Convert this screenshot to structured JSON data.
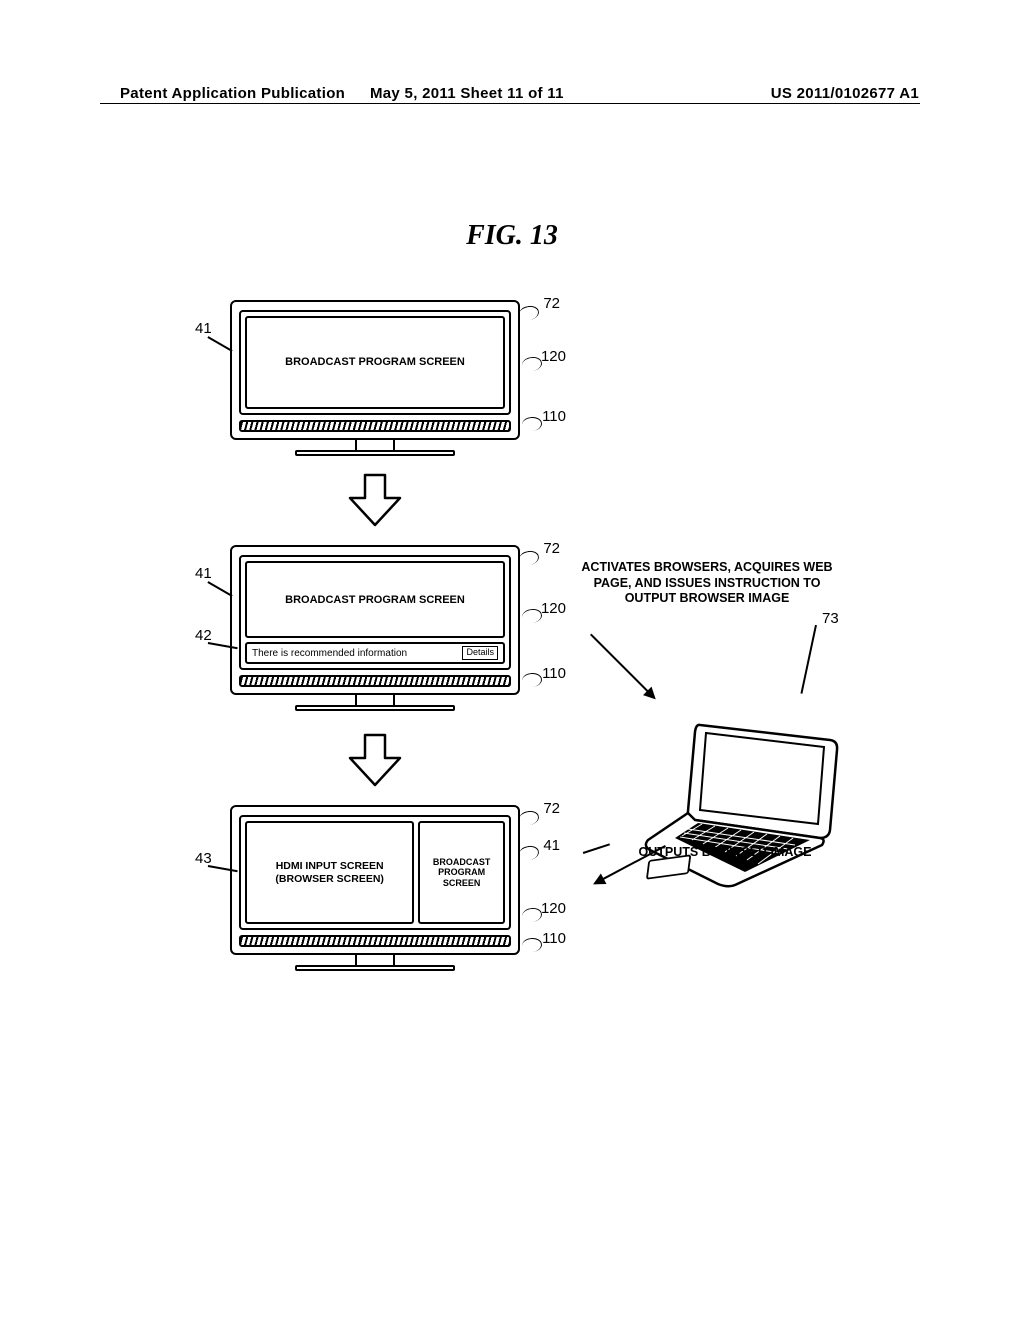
{
  "header": {
    "left": "Patent Application Publication",
    "center": "May 5, 2011   Sheet 11 of 11",
    "right": "US 2011/0102677 A1"
  },
  "figure": {
    "title": "FIG. 13"
  },
  "tv1": {
    "screen_label": "BROADCAST PROGRAM SCREEN",
    "callout_41": "41",
    "callout_72": "72",
    "callout_120": "120",
    "callout_110": "110"
  },
  "tv2": {
    "screen_label": "BROADCAST PROGRAM SCREEN",
    "info_text": "There is recommended information",
    "details_label": "Details",
    "callout_41": "41",
    "callout_42": "42",
    "callout_72": "72",
    "callout_120": "120",
    "callout_110": "110"
  },
  "side": {
    "activates_text": "ACTIVATES BROWSERS, ACQUIRES WEB PAGE, AND ISSUES INSTRUCTION TO OUTPUT BROWSER IMAGE",
    "callout_73": "73",
    "outputs_text": "OUTPUTS BROWSER IMAGE"
  },
  "tv3": {
    "left_label": "HDMI INPUT SCREEN (BROWSER SCREEN)",
    "right_label": "BROADCAST PROGRAM SCREEN",
    "callout_43": "43",
    "callout_41": "41",
    "callout_72": "72",
    "callout_120": "120",
    "callout_110": "110"
  }
}
